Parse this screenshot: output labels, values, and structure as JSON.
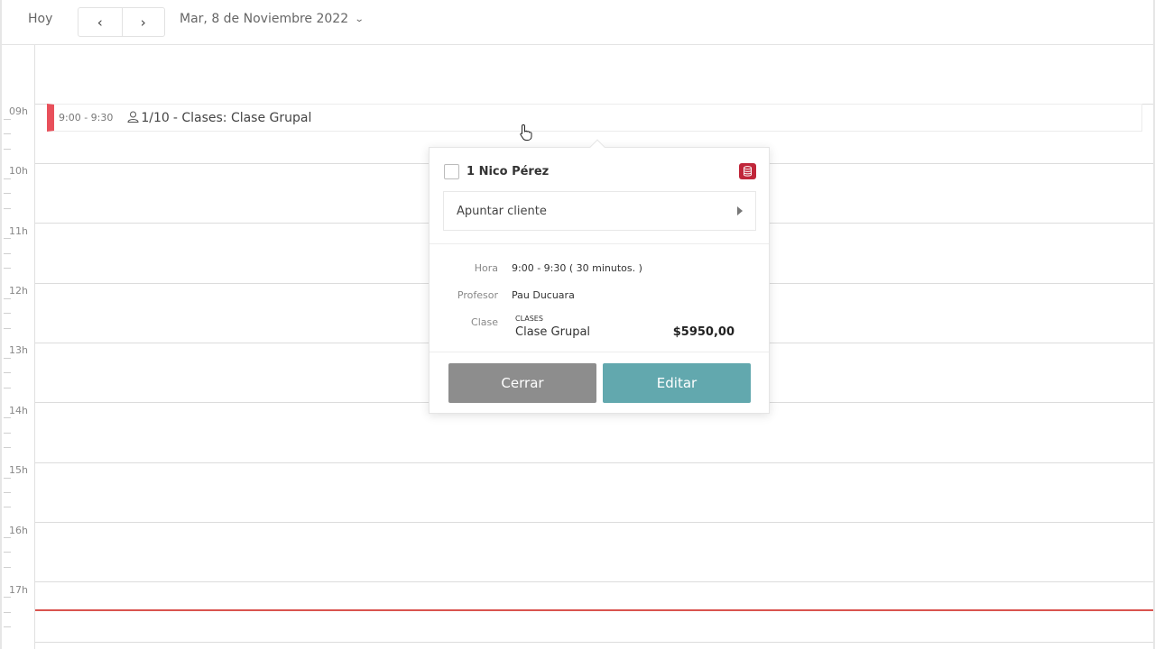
{
  "toolbar": {
    "today_label": "Hoy",
    "prev_glyph": "‹",
    "next_glyph": "›",
    "date_label": "Mar, 8 de Noviembre 2022",
    "dropdown_glyph": "⌄"
  },
  "calendar": {
    "hours": [
      "09h",
      "10h",
      "11h",
      "12h",
      "13h",
      "14h",
      "15h",
      "16h",
      "17h"
    ],
    "now_line_color": "#d9534f"
  },
  "event": {
    "time": "9:00 - 9:30",
    "capacity": "1/10",
    "title": "- Clases: Clase Grupal",
    "accent_color": "#e8505b"
  },
  "popover": {
    "client": "1 Nico Pérez",
    "assign_label": "Apuntar cliente",
    "details": {
      "hora_key": "Hora",
      "hora_val": "9:00 - 9:30 ( 30 minutos. )",
      "profesor_key": "Profesor",
      "profesor_val": "Pau Ducuara",
      "clase_key": "Clase",
      "clase_category": "CLASES",
      "clase_name": "Clase Grupal",
      "clase_price": "$5950,00"
    },
    "close_label": "Cerrar",
    "edit_label": "Editar",
    "close_color": "#8d8d8d",
    "edit_color": "#62a8ae"
  },
  "icons": {
    "person": "person-icon",
    "database": "database-icon",
    "cursor": "hand-cursor-icon"
  }
}
